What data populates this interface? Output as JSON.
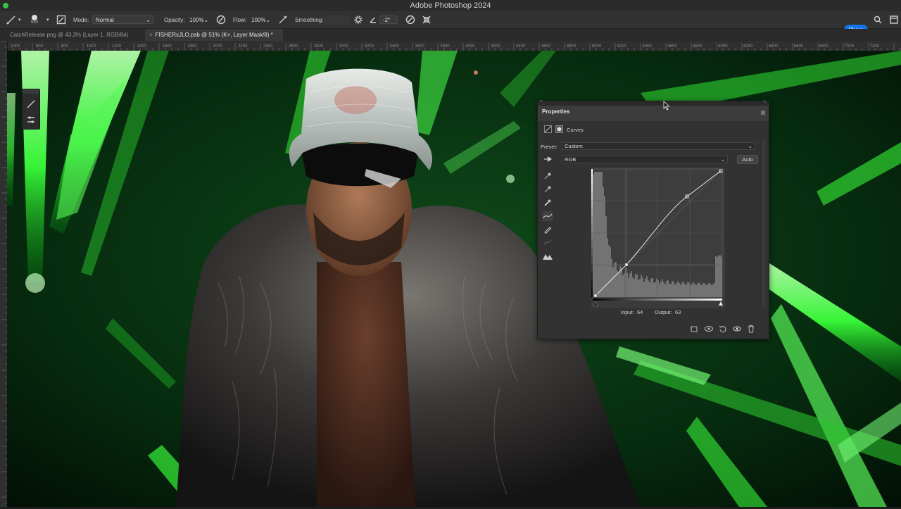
{
  "app": {
    "title": "Adobe Photoshop 2024"
  },
  "options_bar": {
    "brush_size": "530",
    "mode_label": "Mode:",
    "mode_value": "Normal",
    "opacity_label": "Opacity:",
    "opacity_value": "100%",
    "flow_label": "Flow:",
    "flow_value": "100%",
    "smoothing_label": "Smoothing:",
    "angle_value": "-2°",
    "share_label": "Share"
  },
  "tabs": [
    {
      "label": "CatchRelease.png @ 43,3% (Layer 1, RGB/8#)"
    },
    {
      "label": "FISHERxJLO.psb @ 51% (K+, Layer Mask/8) *"
    }
  ],
  "ruler_labels": [
    "1000",
    "600",
    "800",
    "1000",
    "1200",
    "1400",
    "1600",
    "1800",
    "2000",
    "2200",
    "2400",
    "2600",
    "2800",
    "3000",
    "3200",
    "3400",
    "3600",
    "3800",
    "4000",
    "4200",
    "4400",
    "4600",
    "4800",
    "5000",
    "5200",
    "5400",
    "5600",
    "5800",
    "6000",
    "6200",
    "6400",
    "6600",
    "6800",
    "7000",
    "7200"
  ],
  "properties": {
    "title": "Properties",
    "adjustment": "Curves",
    "preset_label": "Preset:",
    "preset_value": "Custom",
    "channel_value": "RGB",
    "auto_label": "Auto",
    "input_label": "Input:",
    "input_value": "64",
    "output_label": "Output:",
    "output_value": "63"
  },
  "colors": {
    "accent": "#1473e6",
    "green_light": "#3aff3a",
    "panel_bg": "#323232"
  }
}
